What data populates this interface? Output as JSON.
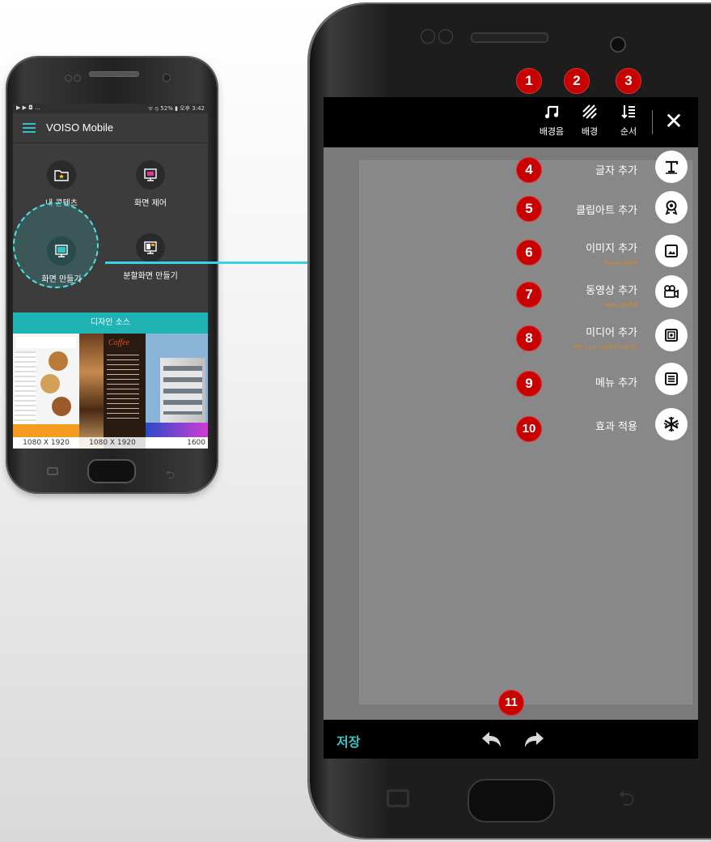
{
  "small_phone": {
    "status": {
      "left": "▶ ▶ ◘ ...",
      "right": "ᯤ ⦸ 52% ▮ 오후 3:42"
    },
    "app_title": "VOISO Mobile",
    "tiles": [
      {
        "label": "내 콘텐츠",
        "icon": "folder-star-icon"
      },
      {
        "label": "화면 제어",
        "icon": "monitor-control-icon"
      },
      {
        "label": "화면 만들기",
        "icon": "monitor-icon"
      },
      {
        "label": "분할화면 만들기",
        "icon": "split-monitor-icon"
      }
    ],
    "design_source_label": "디자인 소스",
    "thumbnails": [
      {
        "size": "1080 X 1920"
      },
      {
        "size": "1080 X 1920"
      },
      {
        "size": "1600"
      }
    ]
  },
  "big_phone": {
    "toolbar": {
      "bgm_label": "배경음",
      "bg_label": "배경",
      "order_label": "순서",
      "close_icon": "close-icon"
    },
    "menu": [
      {
        "label": "글자 추가",
        "sub": "",
        "icon": "text-icon",
        "num": "4"
      },
      {
        "label": "클립아트 추가",
        "sub": "",
        "icon": "clipart-icon",
        "num": "5"
      },
      {
        "label": "이미지 추가",
        "sub": "Media 사용권장",
        "icon": "image-icon",
        "num": "6"
      },
      {
        "label": "동영상 추가",
        "sub": "Media 사용권장",
        "icon": "video-icon",
        "num": "7"
      },
      {
        "label": "미디어 추가",
        "sub": "버전 3.3.xx 이상에서 사용가능",
        "icon": "media-icon",
        "num": "8"
      },
      {
        "label": "메뉴 추가",
        "sub": "",
        "icon": "menu-icon",
        "num": "9"
      },
      {
        "label": "효과 적용",
        "sub": "",
        "icon": "snowflake-icon",
        "num": "10"
      }
    ],
    "toolbar_badges": [
      "1",
      "2",
      "3"
    ],
    "save_label": "저장",
    "undo_badge": "11"
  },
  "colors": {
    "accent": "#1fb3b3",
    "badge": "#c90000",
    "arrow": "#31d6e6",
    "sub_text": "#e2881a"
  }
}
